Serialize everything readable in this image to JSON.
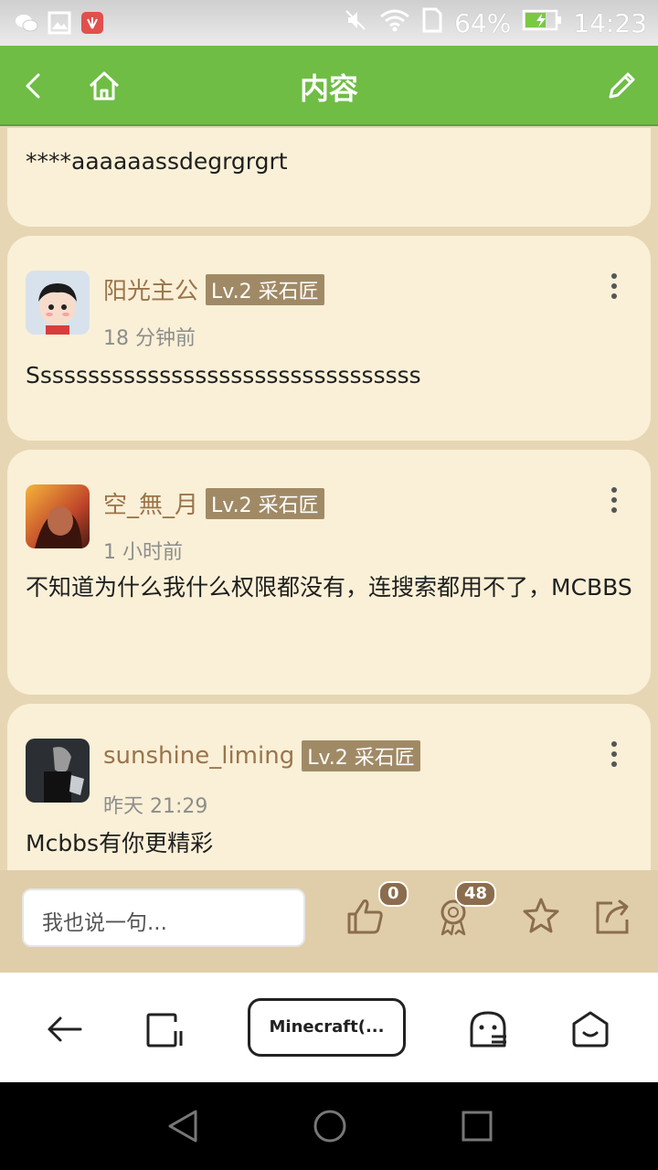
{
  "status_bar": {
    "battery": "64%",
    "time": "14:23"
  },
  "header": {
    "title": "内容"
  },
  "posts": [
    {
      "body": "****aaaaaassdegrgrgrt"
    },
    {
      "username": "阳光主公",
      "level": "Lv.2 采石匠",
      "time": "18 分钟前",
      "body": "Sssssssssssssssssssssssssssssssss"
    },
    {
      "username": "空_無_月",
      "level": "Lv.2 采石匠",
      "time": "1 小时前",
      "body": "不知道为什么我什么权限都没有，连搜索都用不了，MCBBS"
    },
    {
      "username": "sunshine_liming",
      "level": "Lv.2 采石匠",
      "time": "昨天 21:29",
      "body": "Mcbbs有你更精彩"
    }
  ],
  "reply_bar": {
    "placeholder": "我也说一句...",
    "like_count": "0",
    "rate_count": "48"
  },
  "browser_bar": {
    "tab_label": "Minecraft(..."
  }
}
